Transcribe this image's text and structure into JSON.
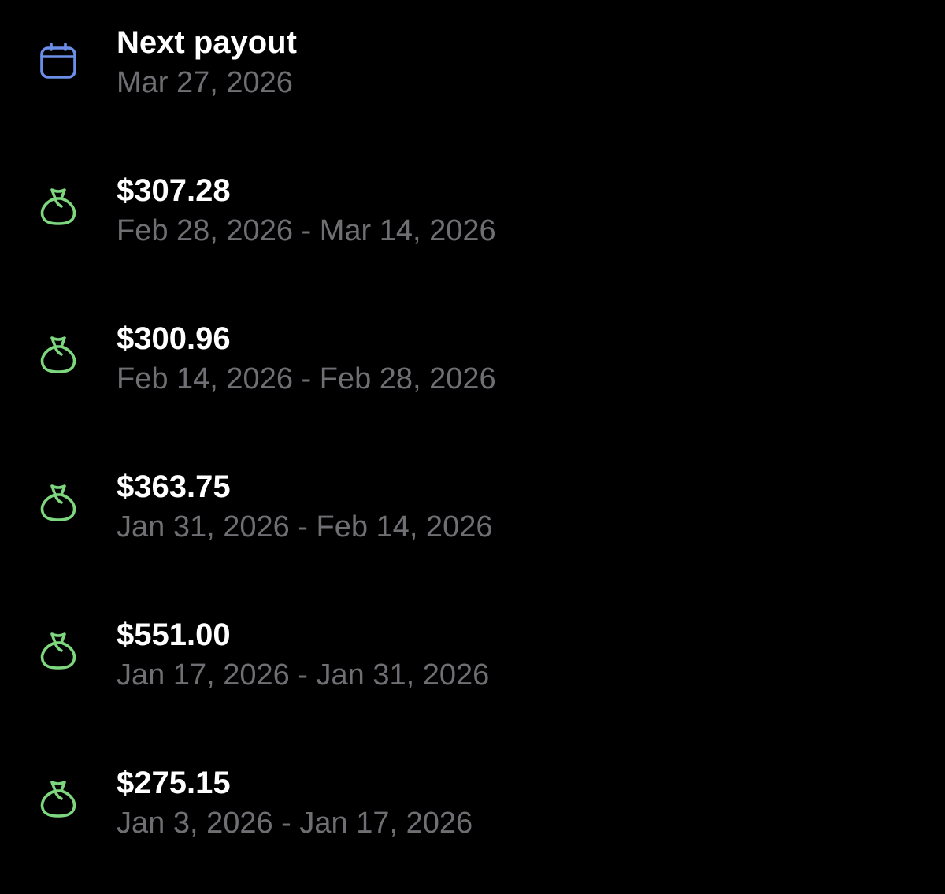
{
  "next_payout": {
    "title": "Next payout",
    "date": "Mar 27, 2026",
    "icon": "calendar-icon",
    "icon_color": "#6b8fe8"
  },
  "payouts": [
    {
      "amount": "$307.28",
      "period": "Feb 28, 2026 - Mar 14, 2026",
      "icon": "money-bag-icon"
    },
    {
      "amount": "$300.96",
      "period": "Feb 14, 2026 - Feb 28, 2026",
      "icon": "money-bag-icon"
    },
    {
      "amount": "$363.75",
      "period": "Jan 31, 2026 - Feb 14, 2026",
      "icon": "money-bag-icon"
    },
    {
      "amount": "$551.00",
      "period": "Jan 17, 2026 - Jan 31, 2026",
      "icon": "money-bag-icon"
    },
    {
      "amount": "$275.15",
      "period": "Jan 3, 2026 - Jan 17, 2026",
      "icon": "money-bag-icon"
    }
  ],
  "colors": {
    "background": "#000000",
    "title": "#ffffff",
    "subtitle": "#6f6f73",
    "payout_icon": "#7ed67e"
  }
}
